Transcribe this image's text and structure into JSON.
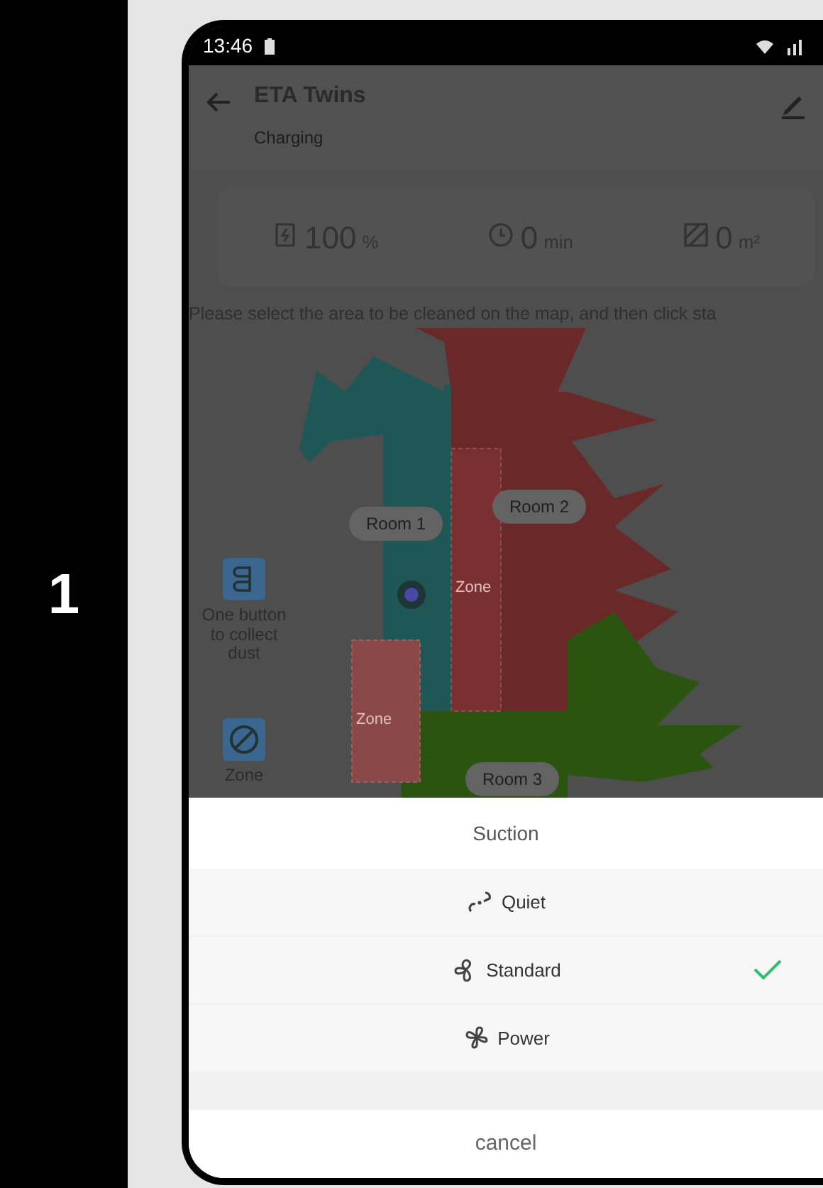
{
  "step": "1",
  "status_bar": {
    "time": "13:46"
  },
  "header": {
    "title": "ETA Twins",
    "subtitle": "Charging"
  },
  "stats": [
    {
      "kind": "battery",
      "value": "100",
      "unit": "%"
    },
    {
      "kind": "time",
      "value": "0",
      "unit": "min"
    },
    {
      "kind": "area",
      "value": "0",
      "unit": "m²"
    }
  ],
  "instruction": "Please select the area to be cleaned on the map, and then click sta",
  "map": {
    "rooms": [
      "Room 1",
      "Room 2",
      "Room 3"
    ],
    "zones": [
      "Zone",
      "Zone"
    ]
  },
  "side_actions": [
    {
      "kind": "dust",
      "label": "One button to collect dust"
    },
    {
      "kind": "zone",
      "label": "Zone"
    }
  ],
  "sheet": {
    "title": "Suction",
    "options": [
      {
        "kind": "quiet",
        "label": "Quiet",
        "selected": false
      },
      {
        "kind": "standard",
        "label": "Standard",
        "selected": true
      },
      {
        "kind": "power",
        "label": "Power",
        "selected": false
      }
    ],
    "cancel": "cancel"
  }
}
